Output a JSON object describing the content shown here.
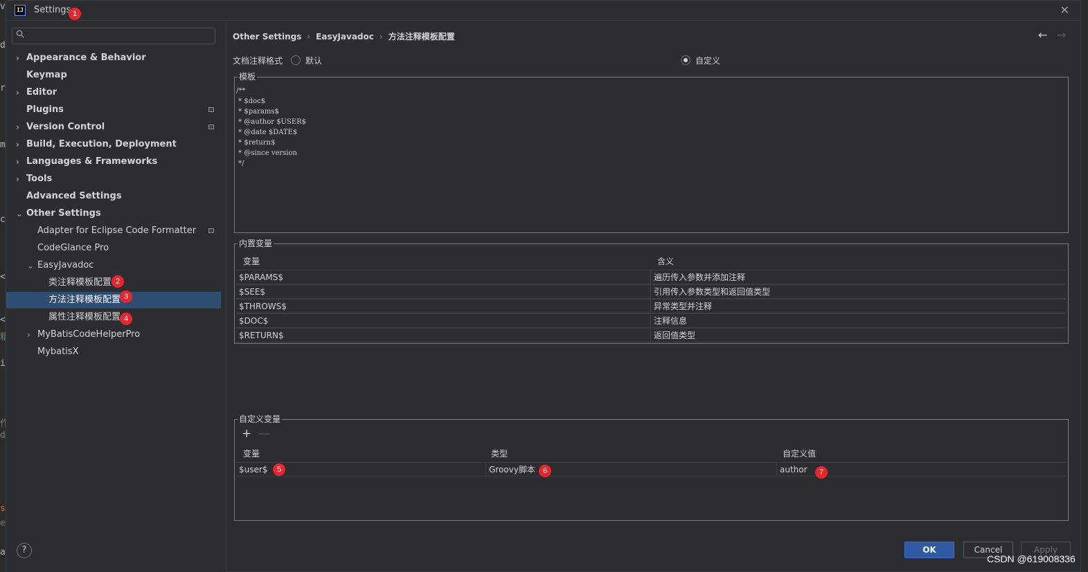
{
  "window": {
    "title": "Settings",
    "close_glyph": "✕",
    "logo_text": "IJ"
  },
  "badges": [
    "1",
    "2",
    "3",
    "4",
    "5",
    "6",
    "7"
  ],
  "background_editor": {
    "chars": [
      "v",
      "d",
      "r",
      "m",
      "c",
      "<",
      "<",
      "粗",
      "i",
      "作",
      "d",
      "s",
      "e",
      "a"
    ]
  },
  "sidebar": {
    "search_placeholder": "",
    "items": [
      {
        "label": "Appearance & Behavior",
        "chevron": "›"
      },
      {
        "label": "Keymap"
      },
      {
        "label": "Editor",
        "chevron": "›"
      },
      {
        "label": "Plugins"
      },
      {
        "label": "Version Control",
        "chevron": "›"
      },
      {
        "label": "Build, Execution, Deployment",
        "chevron": "›"
      },
      {
        "label": "Languages & Frameworks",
        "chevron": "›"
      },
      {
        "label": "Tools",
        "chevron": "›"
      },
      {
        "label": "Advanced Settings"
      },
      {
        "label": "Other Settings",
        "chevron": "⌄"
      },
      {
        "label": "Adapter for Eclipse Code Formatter"
      },
      {
        "label": "CodeGlance Pro"
      },
      {
        "label": "EasyJavadoc",
        "chevron": "⌄"
      },
      {
        "label": "类注释模板配置"
      },
      {
        "label": "方法注释模板配置"
      },
      {
        "label": "属性注释模板配置"
      },
      {
        "label": "MyBatisCodeHelperPro",
        "chevron": "›"
      },
      {
        "label": "MybatisX"
      }
    ],
    "help_label": "?"
  },
  "breadcrumb": {
    "items": [
      "Other Settings",
      "EasyJavadoc",
      "方法注释模板配置"
    ],
    "separator": "›",
    "back_glyph": "←",
    "forward_glyph": "→"
  },
  "format": {
    "label": "文档注释格式",
    "options": [
      "默认",
      "自定义"
    ],
    "selected": "自定义"
  },
  "template": {
    "title": "模板",
    "text": "/**\n * $doc$\n * $params$\n * @author $USER$\n * @date $DATE$\n * $return$\n * @since version\n */"
  },
  "builtin_vars": {
    "title": "内置变量",
    "headers": [
      "变量",
      "含义"
    ],
    "rows": [
      [
        "$PARAMS$",
        "遍历传入参数并添加注释"
      ],
      [
        "$SEE$",
        "引用传入参数类型和返回值类型"
      ],
      [
        "$THROWS$",
        "异常类型并注释"
      ],
      [
        "$DOC$",
        "注释信息"
      ],
      [
        "$RETURN$",
        "返回值类型"
      ]
    ]
  },
  "custom_vars": {
    "title": "自定义变量",
    "add_glyph": "+",
    "remove_glyph": "—",
    "headers": [
      "变量",
      "类型",
      "自定义值"
    ],
    "rows": [
      [
        "$user$",
        "Groovy脚本",
        "author"
      ]
    ]
  },
  "buttons": {
    "ok": "OK",
    "cancel": "Cancel",
    "apply": "Apply"
  },
  "watermark": "CSDN @619008336",
  "colors": {
    "selection": "#2e4d73",
    "badge": "#e8262b",
    "ok_button": "#2f5aa6"
  }
}
